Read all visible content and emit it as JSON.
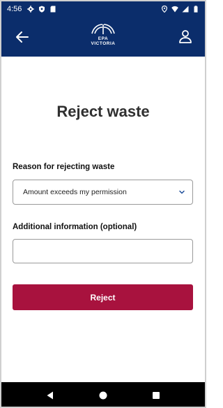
{
  "status_bar": {
    "time": "4:56",
    "left_icons": [
      "gear-icon",
      "shield-icon",
      "sim-card-icon"
    ],
    "right_icons": [
      "location-icon",
      "wifi-icon",
      "signal-icon",
      "battery-icon"
    ]
  },
  "header": {
    "logo_line1": "EPA",
    "logo_line2": "VICTORIA"
  },
  "main": {
    "title": "Reject waste",
    "reason_label": "Reason for rejecting waste",
    "reason_value": "Amount exceeds my permission",
    "info_label": "Additional information (optional)",
    "info_value": "",
    "reject_label": "Reject"
  },
  "colors": {
    "brand_navy": "#0b2d6b",
    "reject_red": "#a8123e",
    "chevron_blue": "#1f4f9a"
  }
}
